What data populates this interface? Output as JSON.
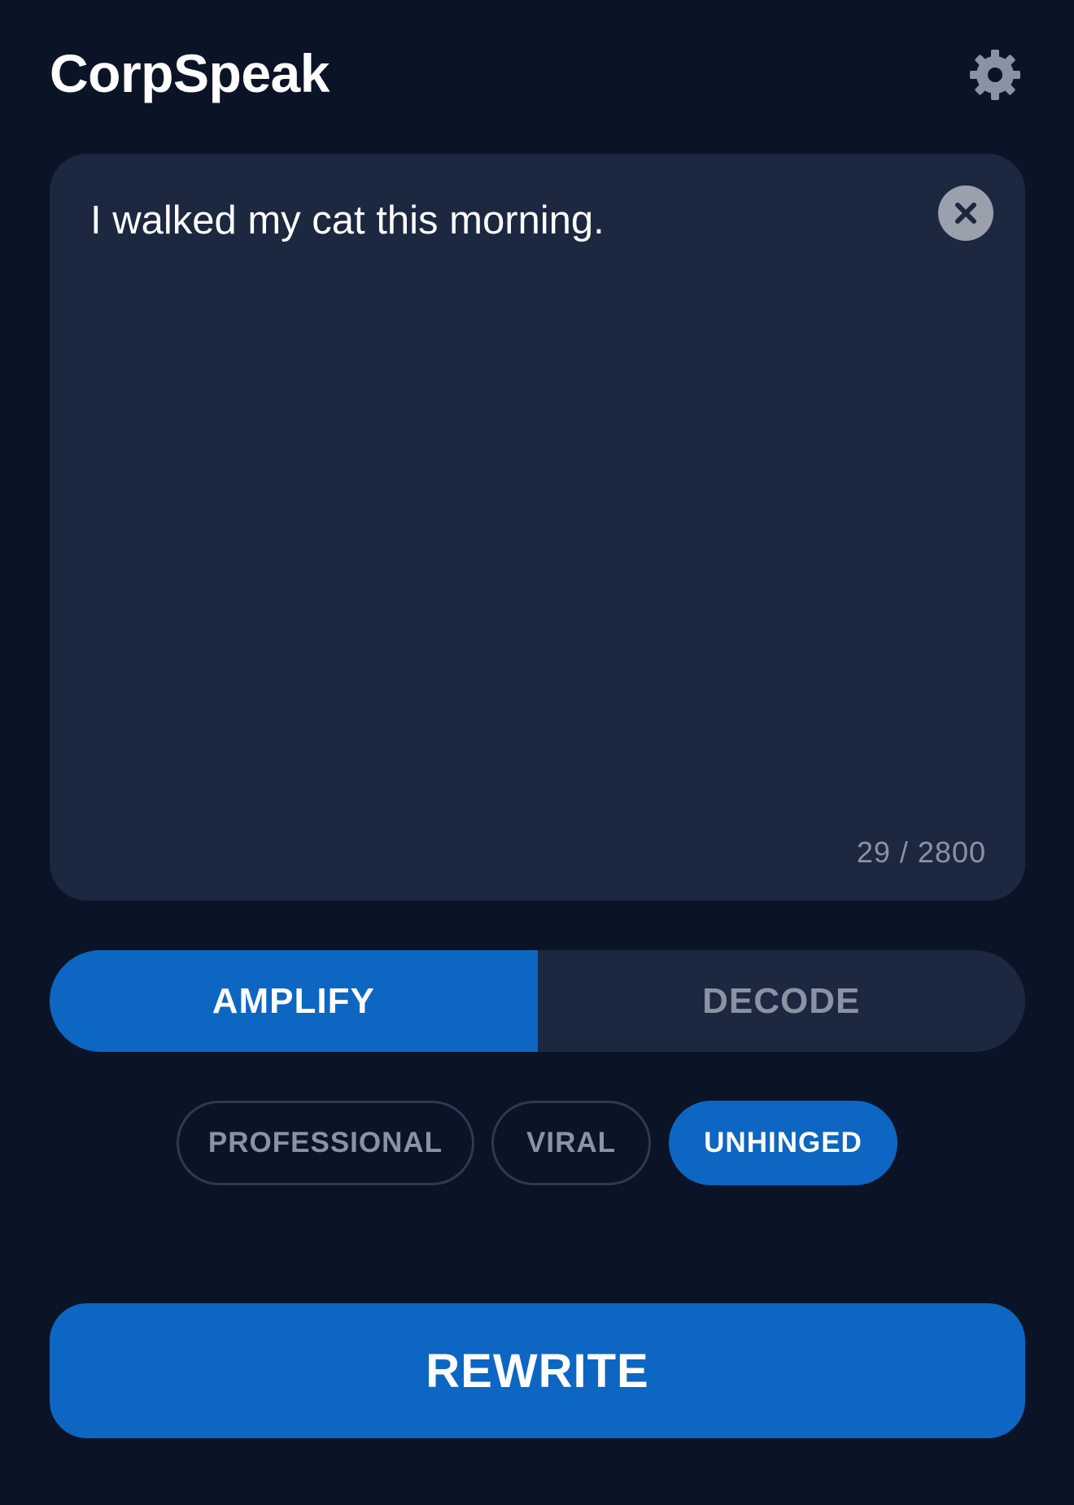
{
  "app": {
    "title": "CorpSpeak",
    "settings_icon": "gear-icon"
  },
  "editor": {
    "text": "I walked my cat this morning.",
    "char_count": "29 / 2800",
    "clear_icon": "close-icon"
  },
  "mode_toggle": {
    "selected": "AMPLIFY",
    "options": [
      {
        "label": "AMPLIFY",
        "active": true
      },
      {
        "label": "DECODE",
        "active": false
      }
    ]
  },
  "tone": {
    "selected": "UNHINGED",
    "options": [
      {
        "label": "PROFESSIONAL",
        "selected": false
      },
      {
        "label": "VIRAL",
        "selected": false
      },
      {
        "label": "UNHINGED",
        "selected": true
      }
    ]
  },
  "actions": {
    "rewrite_label": "REWRITE"
  },
  "colors": {
    "background": "#0b1426",
    "card": "#1b2840",
    "accent": "#0d66c2",
    "muted_text": "#8a93a3",
    "icon_gray": "#9aa1ad"
  }
}
